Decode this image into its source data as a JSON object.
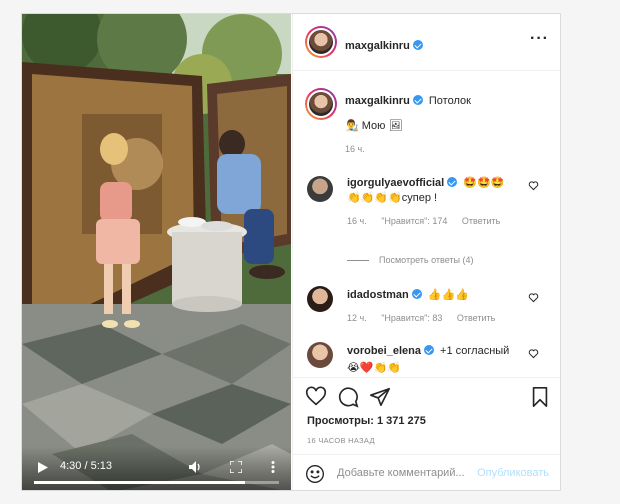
{
  "video": {
    "time": "4:30 / 5:13",
    "progress": 0.862
  },
  "header": {
    "username": "maxgalkinru",
    "verified": true
  },
  "caption": {
    "username": "maxgalkinru",
    "text": "Потолок",
    "line2": "👨‍🎨 Мою 🖼",
    "time": "16 ч."
  },
  "comments": [
    {
      "username": "igorgulyaevofficial",
      "text": "🤩🤩🤩👏👏👏👏супер !",
      "time": "16 ч.",
      "likes": "\"Нравится\": 174",
      "reply": "Ответить"
    },
    {
      "username": "idadostman",
      "text": "👍👍👍",
      "time": "12 ч.",
      "likes": "\"Нравится\": 83",
      "reply": "Ответить"
    },
    {
      "username": "vorobei_elena",
      "text": "+1 согласный",
      "line2": "😭❤️👏👏",
      "time": "",
      "likes": "",
      "reply": ""
    }
  ],
  "view_replies": "Посмотреть ответы (4)",
  "stats": {
    "views": "Просмотры: 1 371 275",
    "timestamp": "16 ЧАСОВ НАЗАД"
  },
  "add_comment": {
    "placeholder": "Добавьте комментарий...",
    "publish": "Опубликовать"
  },
  "colors": {
    "accent": "#3897f0",
    "publish_disabled": "#b2dffc"
  }
}
